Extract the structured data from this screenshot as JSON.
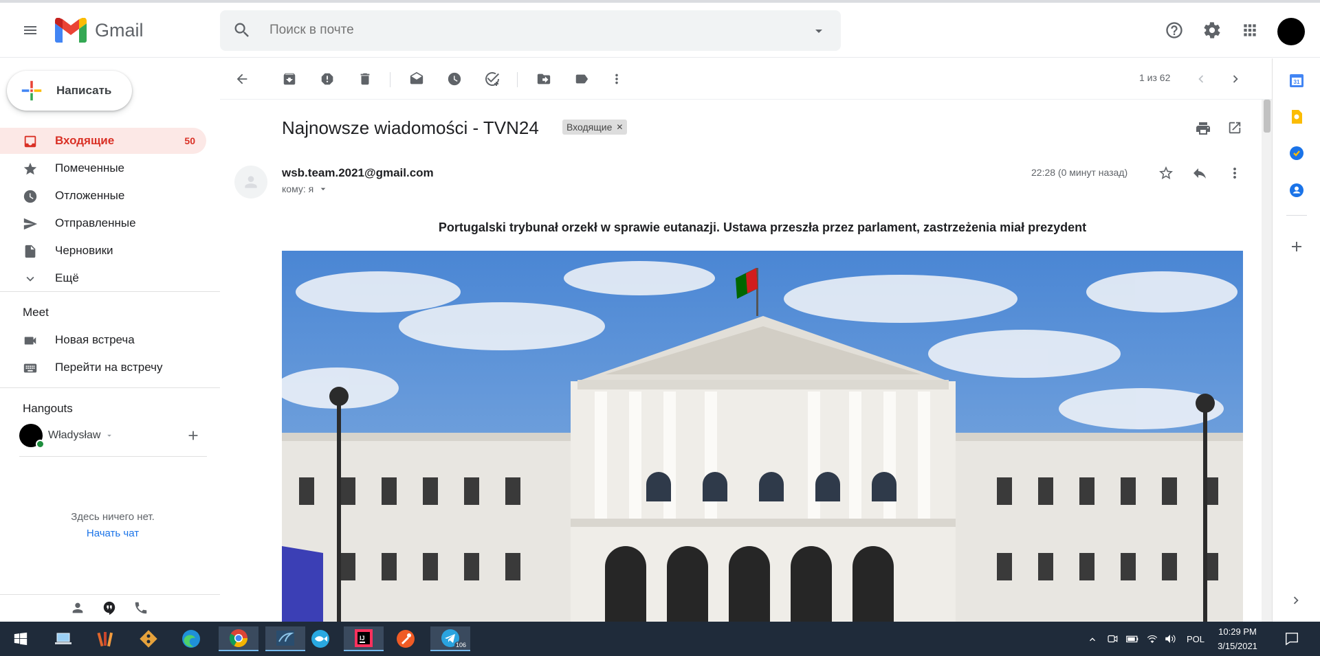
{
  "header": {
    "logo_text": "Gmail",
    "search_placeholder": "Поиск в почте"
  },
  "sidebar": {
    "compose_label": "Написать",
    "items": [
      {
        "label": "Входящие",
        "count": "50",
        "icon": "inbox-icon"
      },
      {
        "label": "Помеченные",
        "icon": "star-icon"
      },
      {
        "label": "Отложенные",
        "icon": "clock-icon"
      },
      {
        "label": "Отправленные",
        "icon": "send-icon"
      },
      {
        "label": "Черновики",
        "icon": "draft-icon"
      },
      {
        "label": "Ещё",
        "icon": "chevron-down-icon"
      }
    ],
    "meet": {
      "title": "Meet",
      "items": [
        {
          "label": "Новая встреча",
          "icon": "video-icon"
        },
        {
          "label": "Перейти на встречу",
          "icon": "keyboard-icon"
        }
      ]
    },
    "hangouts": {
      "title": "Hangouts",
      "user": "Władysław",
      "empty_text": "Здесь ничего нет.",
      "start_chat": "Начать чат"
    }
  },
  "toolbar": {
    "pager": "1 из 62"
  },
  "email": {
    "subject": "Najnowsze wiadomości - TVN24",
    "label_chip": "Входящие",
    "sender": "wsb.team.2021@gmail.com",
    "to_line": "кому: я",
    "time": "22:28 (0 минут назад)",
    "headline": "Portugalski trybunał orzekł w sprawie eutanazji. Ustawa przeszła przez parlament, zastrzeżenia miał prezydent"
  },
  "taskbar": {
    "lang": "POL",
    "time": "10:29 PM",
    "date": "3/15/2021",
    "telegram_badge": "106"
  },
  "colors": {
    "accent_red": "#d93025",
    "active_bg": "#fce8e6",
    "taskbar_bg": "#1f2b3a"
  }
}
